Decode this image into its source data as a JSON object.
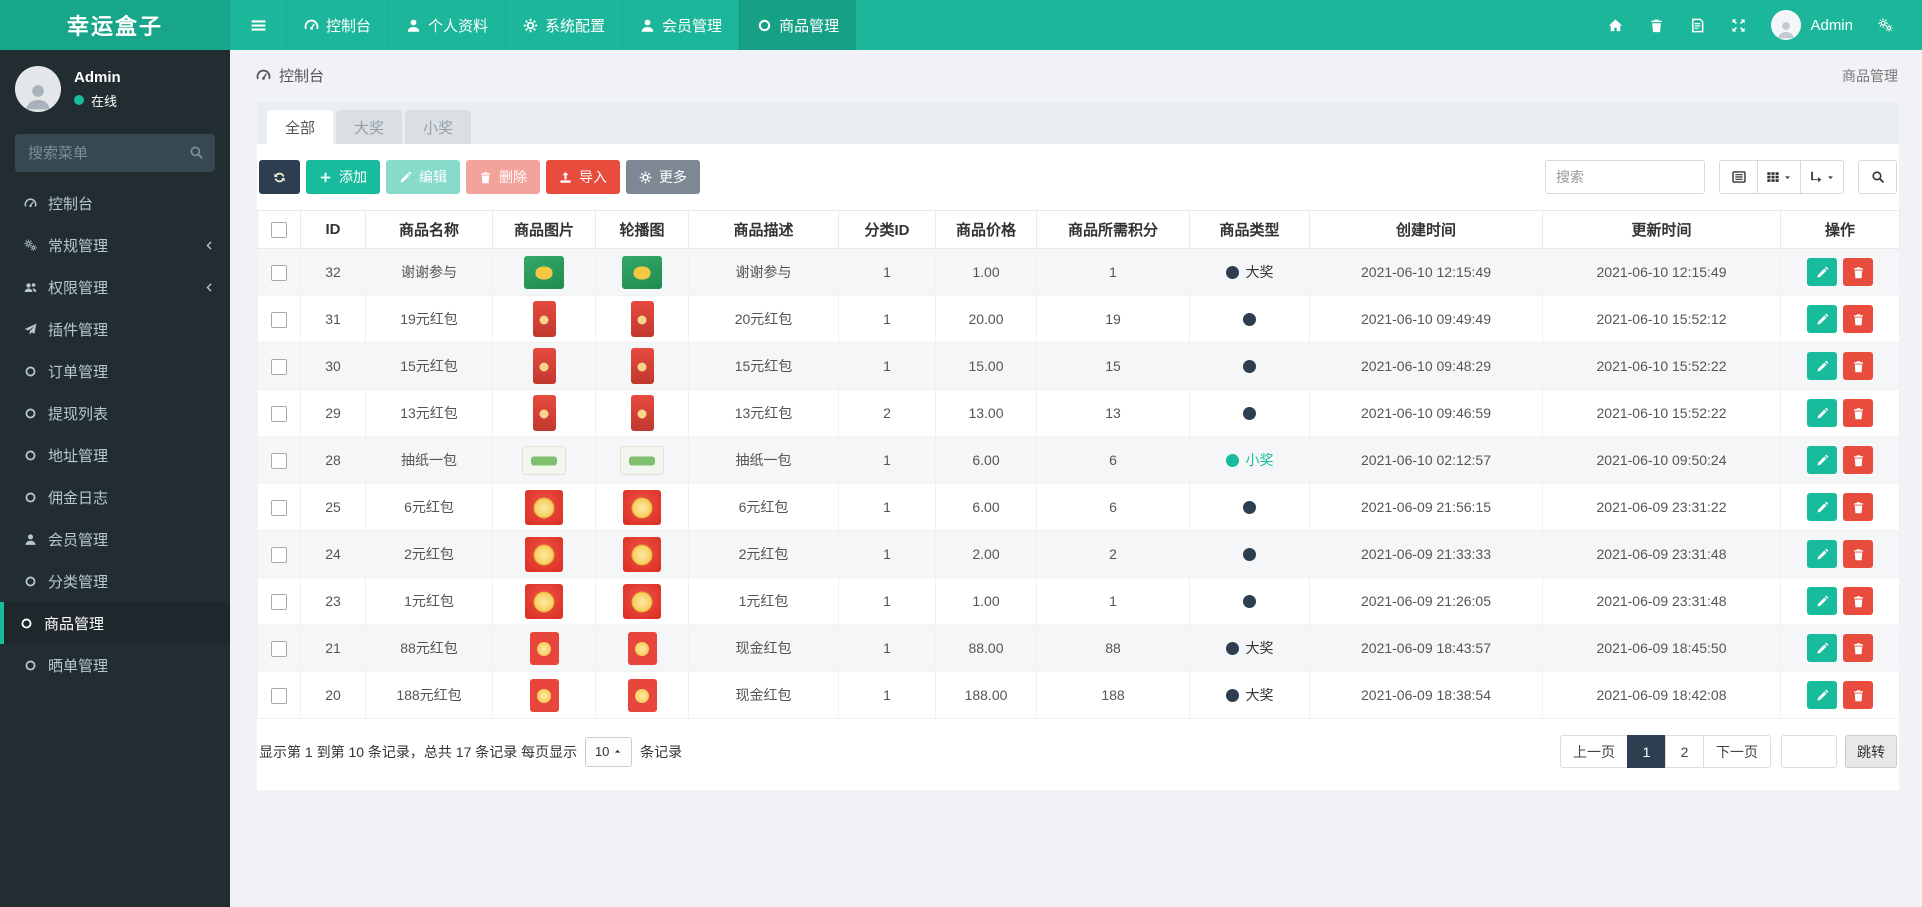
{
  "brand": "幸运盒子",
  "topnav": {
    "menu": [
      {
        "label": "控制台",
        "icon": "tachometer",
        "active": false
      },
      {
        "label": "个人资料",
        "icon": "user",
        "active": false
      },
      {
        "label": "系统配置",
        "icon": "gear",
        "active": false
      },
      {
        "label": "会员管理",
        "icon": "user",
        "active": false
      },
      {
        "label": "商品管理",
        "icon": "circle",
        "active": true
      }
    ],
    "right_icons": [
      {
        "name": "home"
      },
      {
        "name": "trash"
      },
      {
        "name": "cache-file"
      },
      {
        "name": "expand"
      }
    ],
    "user_label": "Admin"
  },
  "sidebar": {
    "user": {
      "name": "Admin",
      "status": "在线"
    },
    "search_placeholder": "搜索菜单",
    "items": [
      {
        "label": "控制台",
        "icon": "tachometer",
        "chevron": false,
        "active": false
      },
      {
        "label": "常规管理",
        "icon": "cogs",
        "chevron": true,
        "active": false
      },
      {
        "label": "权限管理",
        "icon": "users",
        "chevron": true,
        "active": false
      },
      {
        "label": "插件管理",
        "icon": "send",
        "chevron": false,
        "active": false
      },
      {
        "label": "订单管理",
        "icon": "circle",
        "chevron": false,
        "active": false
      },
      {
        "label": "提现列表",
        "icon": "circle",
        "chevron": false,
        "active": false
      },
      {
        "label": "地址管理",
        "icon": "circle",
        "chevron": false,
        "active": false
      },
      {
        "label": "佣金日志",
        "icon": "circle",
        "chevron": false,
        "active": false
      },
      {
        "label": "会员管理",
        "icon": "user",
        "chevron": false,
        "active": false
      },
      {
        "label": "分类管理",
        "icon": "circle",
        "chevron": false,
        "active": false
      },
      {
        "label": "商品管理",
        "icon": "circle",
        "chevron": false,
        "active": true
      },
      {
        "label": "晒单管理",
        "icon": "circle",
        "chevron": false,
        "active": false
      }
    ]
  },
  "breadcrumb": {
    "left": "控制台",
    "right": "商品管理"
  },
  "tabs": [
    {
      "label": "全部",
      "active": true
    },
    {
      "label": "大奖",
      "active": false
    },
    {
      "label": "小奖",
      "active": false
    }
  ],
  "toolbar": {
    "add_label": "添加",
    "edit_label": "编辑",
    "delete_label": "删除",
    "import_label": "导入",
    "more_label": "更多",
    "search_placeholder": "搜索"
  },
  "table": {
    "columns": [
      "ID",
      "商品名称",
      "商品图片",
      "轮播图",
      "商品描述",
      "分类ID",
      "商品价格",
      "商品所需积分",
      "商品类型",
      "创建时间",
      "更新时间",
      "操作"
    ],
    "rows": [
      {
        "id": "32",
        "name": "谢谢参与",
        "image": "green-packet",
        "carousel": "green-packet",
        "desc": "谢谢参与",
        "category_id": "1",
        "price": "1.00",
        "points": "1",
        "type": "big",
        "type_label": "大奖",
        "created": "2021-06-10 12:15:49",
        "updated": "2021-06-10 12:15:49"
      },
      {
        "id": "31",
        "name": "19元红包",
        "image": "red-tall",
        "carousel": "red-tall",
        "desc": "20元红包",
        "category_id": "1",
        "price": "20.00",
        "points": "19",
        "type": "plain",
        "type_label": "",
        "created": "2021-06-10 09:49:49",
        "updated": "2021-06-10 15:52:12"
      },
      {
        "id": "30",
        "name": "15元红包",
        "image": "red-tall",
        "carousel": "red-tall",
        "desc": "15元红包",
        "category_id": "1",
        "price": "15.00",
        "points": "15",
        "type": "plain",
        "type_label": "",
        "created": "2021-06-10 09:48:29",
        "updated": "2021-06-10 15:52:22"
      },
      {
        "id": "29",
        "name": "13元红包",
        "image": "red-tall",
        "carousel": "red-tall",
        "desc": "13元红包",
        "category_id": "2",
        "price": "13.00",
        "points": "13",
        "type": "plain",
        "type_label": "",
        "created": "2021-06-10 09:46:59",
        "updated": "2021-06-10 15:52:22"
      },
      {
        "id": "28",
        "name": "抽纸一包",
        "image": "tissue",
        "carousel": "tissue",
        "desc": "抽纸一包",
        "category_id": "1",
        "price": "6.00",
        "points": "6",
        "type": "small",
        "type_label": "小奖",
        "created": "2021-06-10 02:12:57",
        "updated": "2021-06-10 09:50:24"
      },
      {
        "id": "25",
        "name": "6元红包",
        "image": "red-gold-lg",
        "carousel": "red-gold-lg",
        "desc": "6元红包",
        "category_id": "1",
        "price": "6.00",
        "points": "6",
        "type": "plain",
        "type_label": "",
        "created": "2021-06-09 21:56:15",
        "updated": "2021-06-09 23:31:22"
      },
      {
        "id": "24",
        "name": "2元红包",
        "image": "red-gold-lg",
        "carousel": "red-gold-lg",
        "desc": "2元红包",
        "category_id": "1",
        "price": "2.00",
        "points": "2",
        "type": "plain",
        "type_label": "",
        "created": "2021-06-09 21:33:33",
        "updated": "2021-06-09 23:31:48"
      },
      {
        "id": "23",
        "name": "1元红包",
        "image": "red-gold-lg",
        "carousel": "red-gold-lg",
        "desc": "1元红包",
        "category_id": "1",
        "price": "1.00",
        "points": "1",
        "type": "plain",
        "type_label": "",
        "created": "2021-06-09 21:26:05",
        "updated": "2021-06-09 23:31:48"
      },
      {
        "id": "21",
        "name": "88元红包",
        "image": "red-gold-sm",
        "carousel": "red-gold-sm",
        "desc": "现金红包",
        "category_id": "1",
        "price": "88.00",
        "points": "88",
        "type": "big",
        "type_label": "大奖",
        "created": "2021-06-09 18:43:57",
        "updated": "2021-06-09 18:45:50"
      },
      {
        "id": "20",
        "name": "188元红包",
        "image": "red-gold-sm",
        "carousel": "red-gold-sm",
        "desc": "现金红包",
        "category_id": "1",
        "price": "188.00",
        "points": "188",
        "type": "big",
        "type_label": "大奖",
        "created": "2021-06-09 18:38:54",
        "updated": "2021-06-09 18:42:08"
      }
    ]
  },
  "pagination": {
    "summary_prefix": "显示第 1 到第 10 条记录，总共 17 条记录 每页显示",
    "page_size": "10",
    "summary_suffix": "条记录",
    "prev_label": "上一页",
    "pages": [
      {
        "label": "1",
        "active": true
      },
      {
        "label": "2",
        "active": false
      }
    ],
    "next_label": "下一页",
    "jump_label": "跳转"
  },
  "colors": {
    "accent": "#18BC9C",
    "navbar": "#1CB79A",
    "sidebar": "#222D32",
    "dark": "#2C3E50",
    "danger": "#E74C3C"
  }
}
